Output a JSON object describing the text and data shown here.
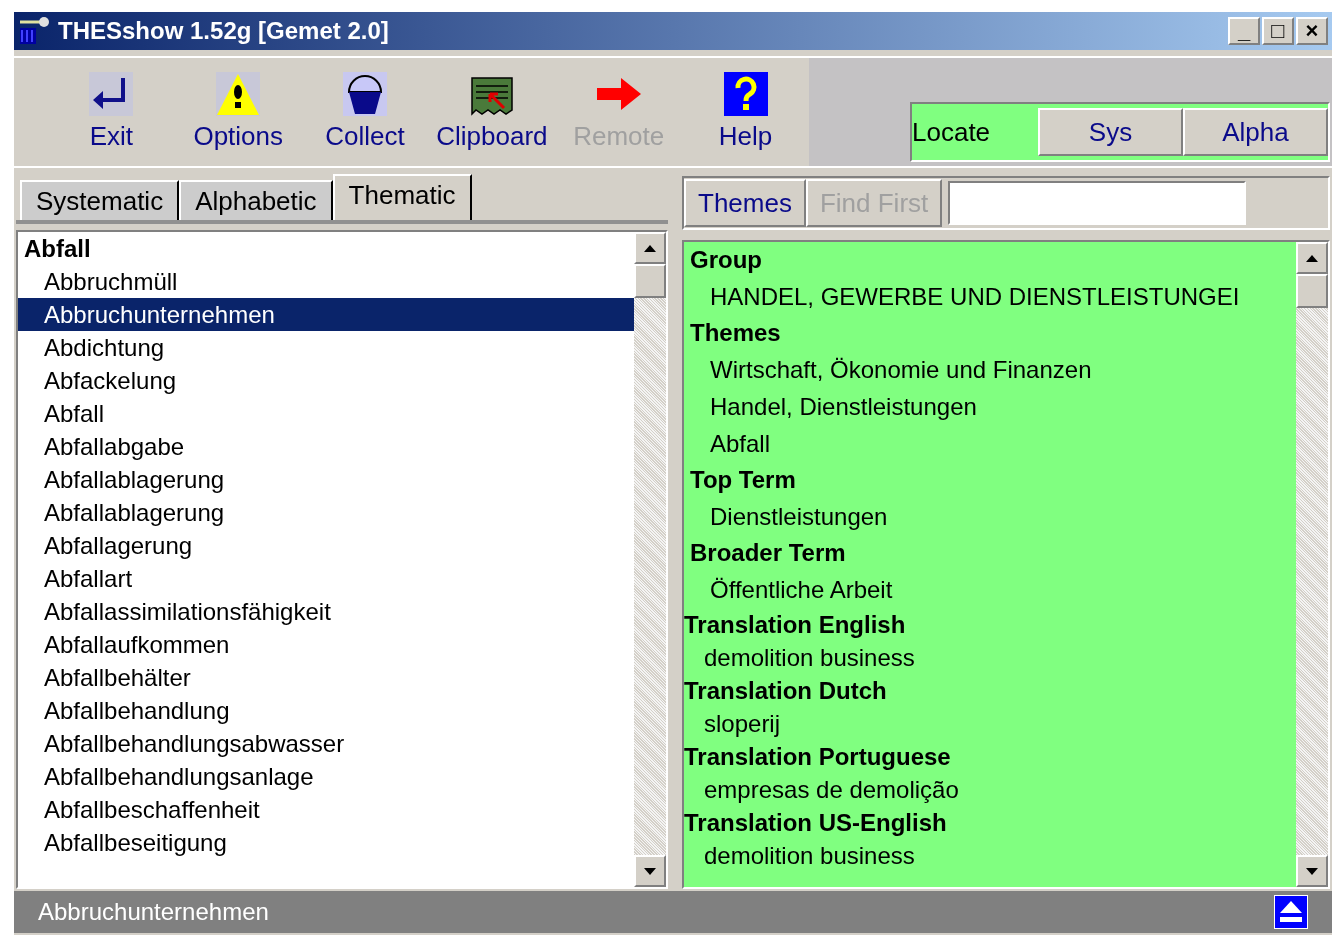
{
  "window": {
    "title": "THESshow 1.52g [Gemet 2.0]",
    "controls": [
      "_",
      "□",
      "×"
    ]
  },
  "toolbar": [
    {
      "label": "Exit",
      "kind": "exit",
      "disabled": false
    },
    {
      "label": "Options",
      "kind": "options",
      "disabled": false
    },
    {
      "label": "Collect",
      "kind": "collect",
      "disabled": false
    },
    {
      "label": "Clipboard",
      "kind": "clipboard",
      "disabled": false
    },
    {
      "label": "Remote",
      "kind": "remote",
      "disabled": true
    },
    {
      "label": "Help",
      "kind": "help",
      "disabled": false
    }
  ],
  "locate": {
    "label": "Locate",
    "buttons": [
      "Sys",
      "Alpha"
    ]
  },
  "tabs": [
    {
      "label": "Systematic",
      "selected": false
    },
    {
      "label": "Alphabetic",
      "selected": false
    },
    {
      "label": "Thematic",
      "selected": true
    }
  ],
  "list": {
    "heading": "Abfall",
    "items": [
      {
        "label": "Abbruchmüll",
        "selected": false
      },
      {
        "label": "Abbruchunternehmen",
        "selected": true
      },
      {
        "label": "Abdichtung",
        "selected": false
      },
      {
        "label": "Abfackelung",
        "selected": false
      },
      {
        "label": "Abfall",
        "selected": false
      },
      {
        "label": "Abfallabgabe",
        "selected": false
      },
      {
        "label": "Abfallablagerung",
        "selected": false
      },
      {
        "label": "Abfallablagerung",
        "selected": false
      },
      {
        "label": "Abfallagerung",
        "selected": false
      },
      {
        "label": "Abfallart",
        "selected": false
      },
      {
        "label": "Abfallassimilationsfähigkeit",
        "selected": false
      },
      {
        "label": "Abfallaufkommen",
        "selected": false
      },
      {
        "label": "Abfallbehälter",
        "selected": false
      },
      {
        "label": "Abfallbehandlung",
        "selected": false
      },
      {
        "label": "Abfallbehandlungsabwasser",
        "selected": false
      },
      {
        "label": "Abfallbehandlungsanlage",
        "selected": false
      },
      {
        "label": "Abfallbeschaffenheit",
        "selected": false
      },
      {
        "label": "Abfallbeseitigung",
        "selected": false
      }
    ]
  },
  "detail": {
    "buttons": [
      {
        "label": "Themes",
        "disabled": false
      },
      {
        "label": "Find First",
        "disabled": true
      }
    ],
    "sections": [
      {
        "heading": "Group",
        "kind": "relation",
        "items": [
          "HANDEL, GEWERBE UND DIENSTLEISTUNGEI"
        ]
      },
      {
        "heading": "Themes",
        "kind": "relation",
        "items": [
          "Wirtschaft, Ökonomie und Finanzen",
          "Handel, Dienstleistungen",
          "Abfall"
        ]
      },
      {
        "heading": "Top Term",
        "kind": "relation",
        "items": [
          "Dienstleistungen"
        ]
      },
      {
        "heading": "Broader Term",
        "kind": "relation",
        "items": [
          "Öffentliche Arbeit"
        ]
      },
      {
        "heading": "Translation English",
        "kind": "translation",
        "items": [
          "demolition business"
        ]
      },
      {
        "heading": "Translation Dutch",
        "kind": "translation",
        "items": [
          "sloperij"
        ]
      },
      {
        "heading": "Translation Portuguese",
        "kind": "translation",
        "items": [
          "empresas de demolição"
        ]
      },
      {
        "heading": "Translation US-English",
        "kind": "translation",
        "items": [
          "demolition business"
        ]
      }
    ]
  },
  "status_bar": {
    "text": "Abbruchunternehmen"
  }
}
